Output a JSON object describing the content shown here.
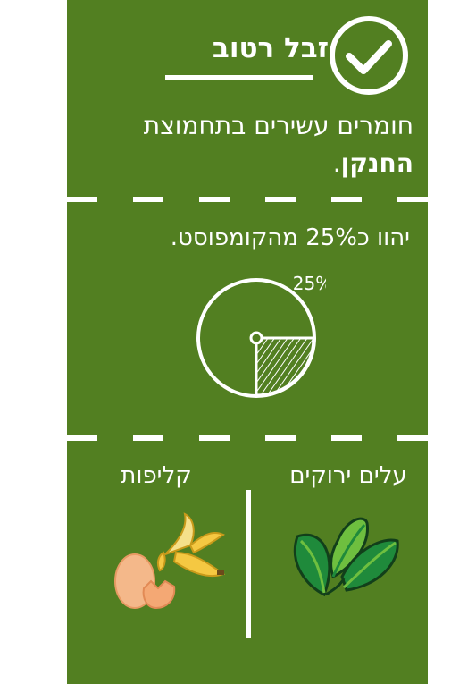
{
  "title": "זבל רטוב",
  "description": {
    "line1": "חומרים עשירים בתחמוצת",
    "line2_bold": "החנקן",
    "line2_end": "."
  },
  "stat": {
    "text": "יהוו כ25% מהקומפוסט.",
    "pie_label": "25%",
    "fraction": 0.25
  },
  "columns": {
    "leaves_label": "עלים ירוקים",
    "peels_label": "קליפות"
  },
  "colors": {
    "background": "#527f21",
    "foreground": "#ffffff",
    "leaf_dark": "#1f8a3b",
    "leaf_light": "#6ebf3f",
    "banana": "#f5c842",
    "egg": "#f4b88a"
  },
  "icons": [
    "check-circle-icon",
    "pie-chart-icon",
    "leaves-icon",
    "banana-peel-icon",
    "egg-shell-icon"
  ]
}
